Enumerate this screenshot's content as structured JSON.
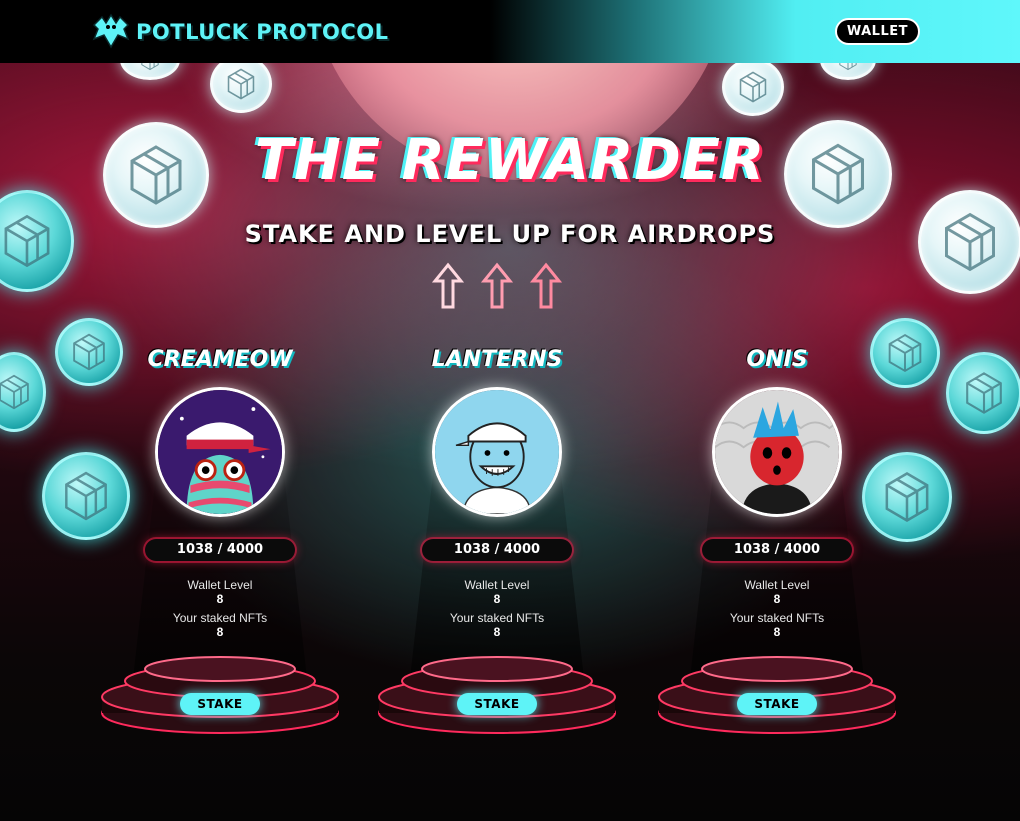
{
  "header": {
    "logo_text": "POTLUCK PROTOCOL",
    "wallet_label": "WALLET"
  },
  "hero": {
    "title": "THE REWARDER",
    "subtitle": "STAKE AND LEVEL UP FOR AIRDROPS"
  },
  "cards": [
    {
      "name": "CREAMEOW",
      "counter": "1038 / 4000",
      "wallet_level_label": "Wallet Level",
      "wallet_level_value": "8",
      "staked_label": "Your staked NFTs",
      "staked_value": "8",
      "stake_label": "STAKE"
    },
    {
      "name": "LANTERNS",
      "counter": "1038 / 4000",
      "wallet_level_label": "Wallet Level",
      "wallet_level_value": "8",
      "staked_label": "Your staked NFTs",
      "staked_value": "8",
      "stake_label": "STAKE"
    },
    {
      "name": "ONIS",
      "counter": "1038 / 4000",
      "wallet_level_label": "Wallet Level",
      "wallet_level_value": "8",
      "staked_label": "Your staked NFTs",
      "staked_value": "8",
      "stake_label": "STAKE"
    }
  ],
  "colors": {
    "accent": "#5ef3f7",
    "neon_red": "#ff2a5c",
    "background_dark": "#0b0607"
  },
  "icons": [
    "bat-logo-icon",
    "token-coin-icon",
    "up-arrow-icon",
    "cat-avatar-icon",
    "lantern-avatar-icon",
    "oni-avatar-icon"
  ]
}
